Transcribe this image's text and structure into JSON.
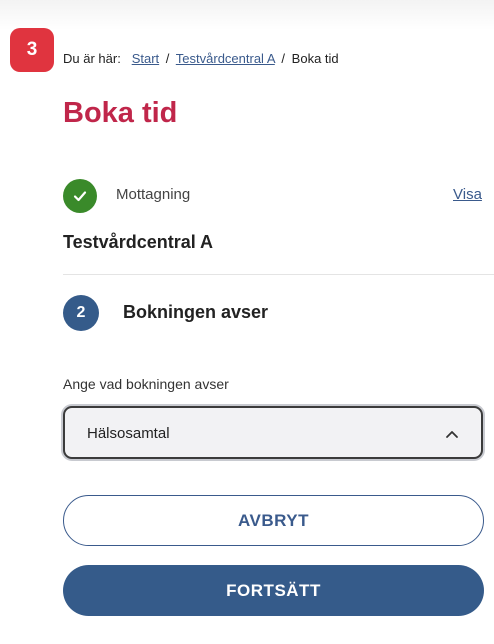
{
  "step_badge": "3",
  "breadcrumb": {
    "prefix": "Du är här:",
    "items": [
      "Start",
      "Testvårdcentral A",
      "Boka tid"
    ],
    "separator": "/"
  },
  "page_title": "Boka tid",
  "completed_step": {
    "label": "Mottagning",
    "value": "Testvårdcentral A",
    "action": "Visa"
  },
  "current_step": {
    "number": "2",
    "title": "Bokningen avser"
  },
  "booking_type": {
    "label": "Ange vad bokningen avser",
    "selected": "Hälsosamtal"
  },
  "buttons": {
    "cancel": "AVBRYT",
    "continue": "FORTSÄTT"
  },
  "colors": {
    "title": "#c0264a",
    "badge": "#e0343f",
    "primary": "#355b8a",
    "success": "#3a8a2a"
  },
  "icons": {
    "completed": "check-icon",
    "select": "chevron-up-icon"
  }
}
